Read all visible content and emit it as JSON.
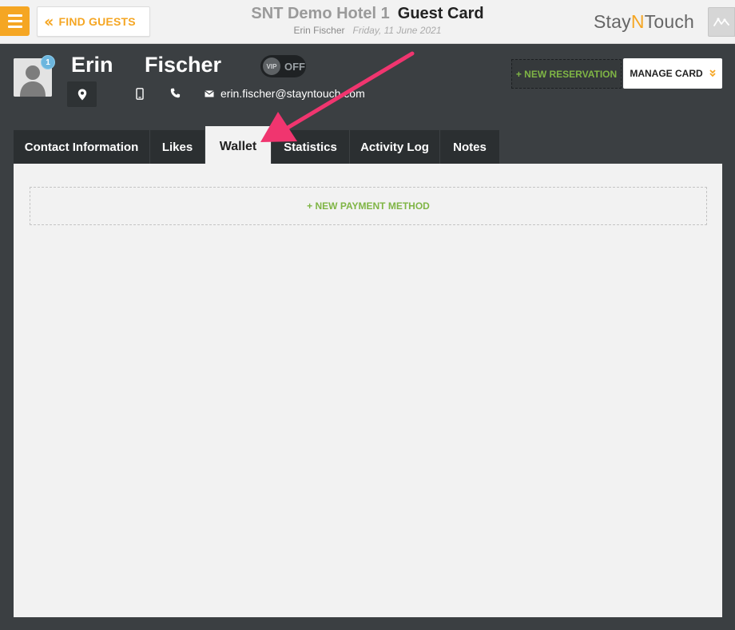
{
  "header": {
    "find_guests_label": "FIND GUESTS",
    "hotel_name": "SNT Demo Hotel 1",
    "page_title": "Guest Card",
    "guest_name": "Erin Fischer",
    "date": "Friday, 11 June 2021",
    "brand_prefix": "Stay",
    "brand_accent": "N",
    "brand_suffix": "Touch"
  },
  "guest": {
    "first_name": "Erin",
    "last_name": "Fischer",
    "badge_count": "1",
    "vip_label": "VIP",
    "vip_state": "OFF",
    "email": "erin.fischer@stayntouch.com"
  },
  "actions": {
    "new_reservation_label": "+ NEW RESERVATION",
    "manage_card_label": "MANAGE CARD"
  },
  "tabs": [
    {
      "label": "Contact Information",
      "active": false
    },
    {
      "label": "Likes",
      "active": false
    },
    {
      "label": "Wallet",
      "active": true
    },
    {
      "label": "Statistics",
      "active": false
    },
    {
      "label": "Activity Log",
      "active": false
    },
    {
      "label": "Notes",
      "active": false
    }
  ],
  "wallet": {
    "new_payment_label": "+ NEW PAYMENT METHOD"
  },
  "colors": {
    "accent_orange": "#f5a623",
    "accent_green": "#7fb545",
    "annotation_pink": "#f0356f",
    "dark_bg": "#3b3f42"
  },
  "icons": [
    "hamburger-menu-icon",
    "double-chevron-left-icon",
    "pulse-icon",
    "avatar-placeholder-icon",
    "location-pin-icon",
    "mobile-phone-icon",
    "phone-icon",
    "envelope-icon",
    "chevron-down-icon"
  ]
}
